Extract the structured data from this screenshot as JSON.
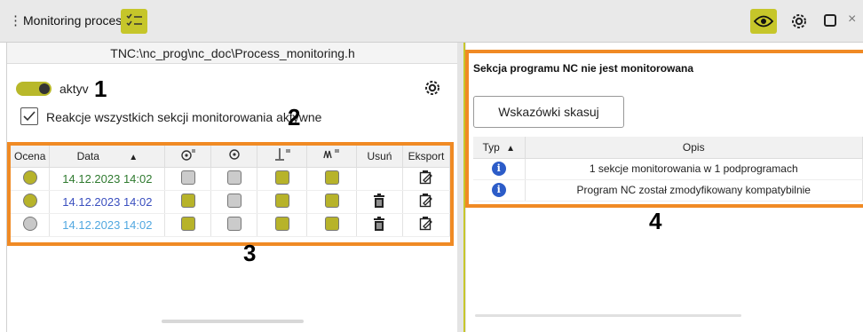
{
  "window": {
    "menu_glyph": "⋮",
    "title": "Monitoring procesu"
  },
  "toolbar_icons": {
    "list": "list-check-icon",
    "eye": "eye-icon",
    "gear": "gear-icon",
    "maximize": "maximize-icon",
    "close": "close-icon",
    "close_glyph": "×"
  },
  "left": {
    "path": "TNC:\\nc_prog\\nc_doc\\Process_monitoring.h",
    "toggle_label": "aktyv",
    "toggle_on": true,
    "callout_1": "1",
    "checkbox_label": "Reakcje wszystkich sekcji monitorowania aktywne",
    "callout_2": "2",
    "callout_3": "3",
    "table": {
      "headers": {
        "ocena": "Ocena",
        "data": "Data",
        "sort_arrow": "▲",
        "usun": "Usuń",
        "eksport": "Eksport"
      },
      "rows": [
        {
          "date": "14.12.2023 14:02",
          "date_color": "#2f7a2f",
          "dot_color": "#b7b32a",
          "c1": false,
          "c2": false,
          "c3": true,
          "c4": true,
          "deletable": false
        },
        {
          "date": "14.12.2023 14:02",
          "date_color": "#3a4fbf",
          "dot_color": "#b7b32a",
          "c1": true,
          "c2": false,
          "c3": true,
          "c4": true,
          "deletable": true
        },
        {
          "date": "14.12.2023 14:02",
          "date_color": "#52a8e0",
          "dot_color": "#c8c8c8",
          "c1": true,
          "c2": false,
          "c3": true,
          "c4": true,
          "deletable": true
        }
      ]
    }
  },
  "right": {
    "title": "Sekcja programu NC nie jest monitorowana",
    "button": "Wskazówki skasuj",
    "callout_4": "4",
    "table": {
      "headers": {
        "typ": "Typ",
        "sort_arrow": "▲",
        "opis": "Opis"
      },
      "rows": [
        {
          "icon": "info-icon",
          "opis": "1 sekcje monitorowania w 1 podprogramach"
        },
        {
          "icon": "info-icon",
          "opis": "Program NC został zmodyfikowany kompatybilnie"
        }
      ]
    }
  },
  "colors": {
    "accent": "#c6c62a",
    "callout_frame": "#f08a24",
    "info": "#2c5cc8"
  }
}
